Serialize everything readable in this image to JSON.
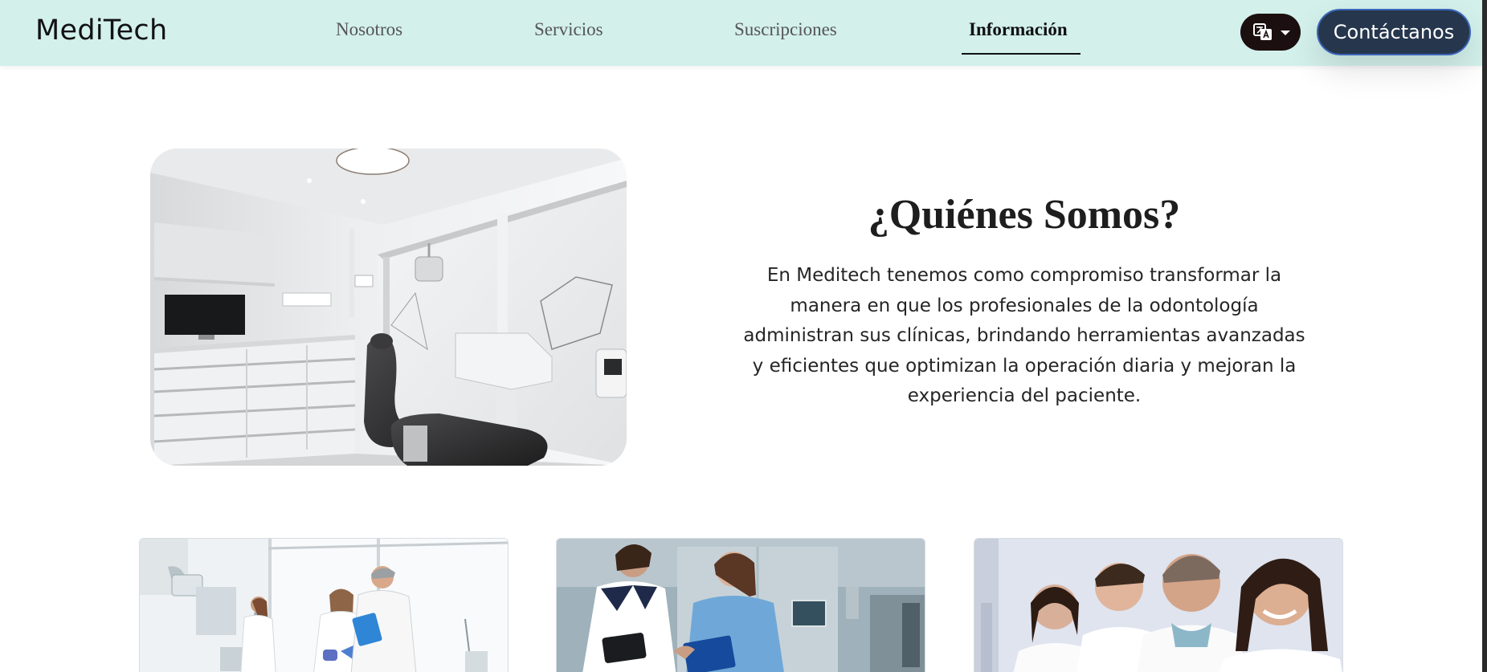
{
  "brand": {
    "name": "MediTech"
  },
  "nav": {
    "items": [
      {
        "label": "Nosotros"
      },
      {
        "label": "Servicios"
      },
      {
        "label": "Suscripciones"
      },
      {
        "label": "Información"
      }
    ],
    "active": "Información"
  },
  "language_button": {
    "icon": "translate-icon"
  },
  "contact_button": {
    "label": "Contáctanos"
  },
  "hero": {
    "image": "dental-office-photo",
    "title": "¿Quiénes Somos?",
    "text": "En Meditech tenemos como compromiso transformar la manera en que los profesionales de la odontología administran sus clínicas, brindando herramientas avanzadas y eficientes que optimizan la operación diaria y mejoran la experiencia del paciente."
  },
  "cards": [
    {
      "image": "dental-team-reviewing-documents-photo"
    },
    {
      "image": "dental-assistants-talking-photo"
    },
    {
      "image": "smiling-dental-team-photo"
    }
  ],
  "colors": {
    "navbar_bg": "#d3f0eb",
    "contact_bg": "#26364d",
    "contact_border": "#3b66b8",
    "language_bg": "#1c0f10"
  }
}
